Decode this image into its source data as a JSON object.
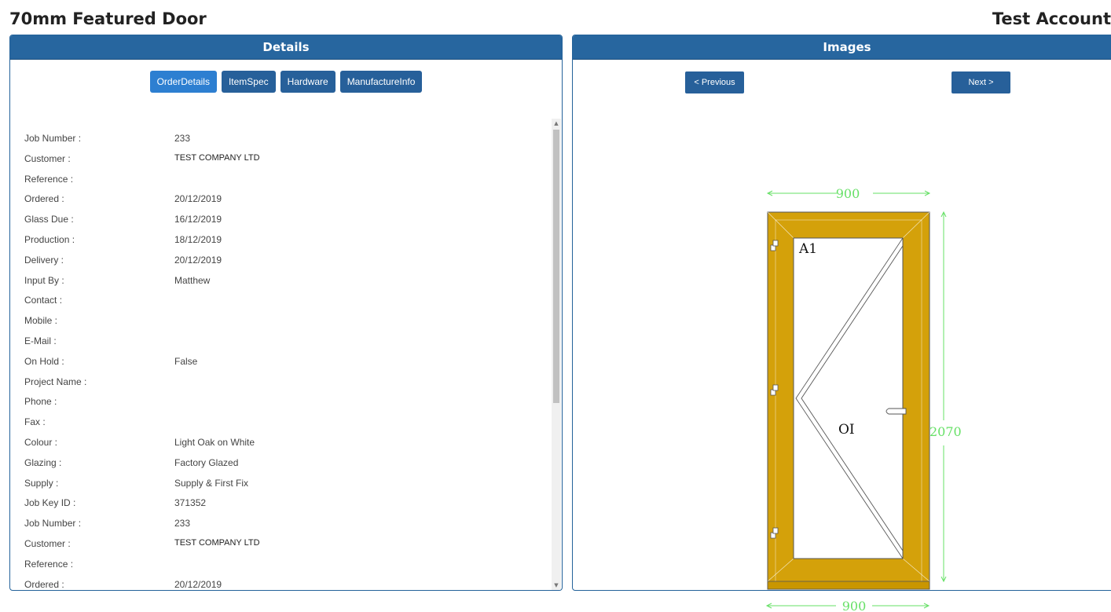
{
  "page": {
    "title": "70mm Featured Door",
    "account": "Test Account"
  },
  "details": {
    "header": "Details",
    "tabs": [
      {
        "label": "OrderDetails",
        "active": true
      },
      {
        "label": "ItemSpec",
        "active": false
      },
      {
        "label": "Hardware",
        "active": false
      },
      {
        "label": "ManufactureInfo",
        "active": false
      }
    ],
    "rows": [
      {
        "label": "Job Number :",
        "value": "233"
      },
      {
        "label": "Customer :",
        "value": "TEST COMPANY LTD"
      },
      {
        "label": "Reference :",
        "value": ""
      },
      {
        "label": "Ordered :",
        "value": "20/12/2019"
      },
      {
        "label": "Glass Due :",
        "value": "16/12/2019"
      },
      {
        "label": "Production :",
        "value": "18/12/2019"
      },
      {
        "label": "Delivery :",
        "value": "20/12/2019"
      },
      {
        "label": "Input By :",
        "value": "Matthew"
      },
      {
        "label": "Contact :",
        "value": ""
      },
      {
        "label": "Mobile :",
        "value": ""
      },
      {
        "label": "E-Mail :",
        "value": ""
      },
      {
        "label": "On Hold :",
        "value": "False"
      },
      {
        "label": "Project Name :",
        "value": ""
      },
      {
        "label": "Phone :",
        "value": ""
      },
      {
        "label": "Fax :",
        "value": ""
      },
      {
        "label": "Colour :",
        "value": "Light Oak on White"
      },
      {
        "label": "Glazing :",
        "value": "Factory Glazed"
      },
      {
        "label": "Supply :",
        "value": "Supply & First Fix"
      },
      {
        "label": "Job Key ID :",
        "value": "371352"
      },
      {
        "label": "Job Number :",
        "value": "233"
      },
      {
        "label": "Customer :",
        "value": "TEST COMPANY LTD"
      },
      {
        "label": "Reference :",
        "value": ""
      },
      {
        "label": "Ordered :",
        "value": "20/12/2019"
      }
    ]
  },
  "images": {
    "header": "Images",
    "prev_label": "< Previous",
    "next_label": "Next >",
    "drawing": {
      "width_label": "900",
      "height_label": "2070",
      "sash_label": "A1",
      "opening_label": "OI",
      "frame_color": "#d4a10a",
      "dimension_color": "#66e066"
    }
  }
}
